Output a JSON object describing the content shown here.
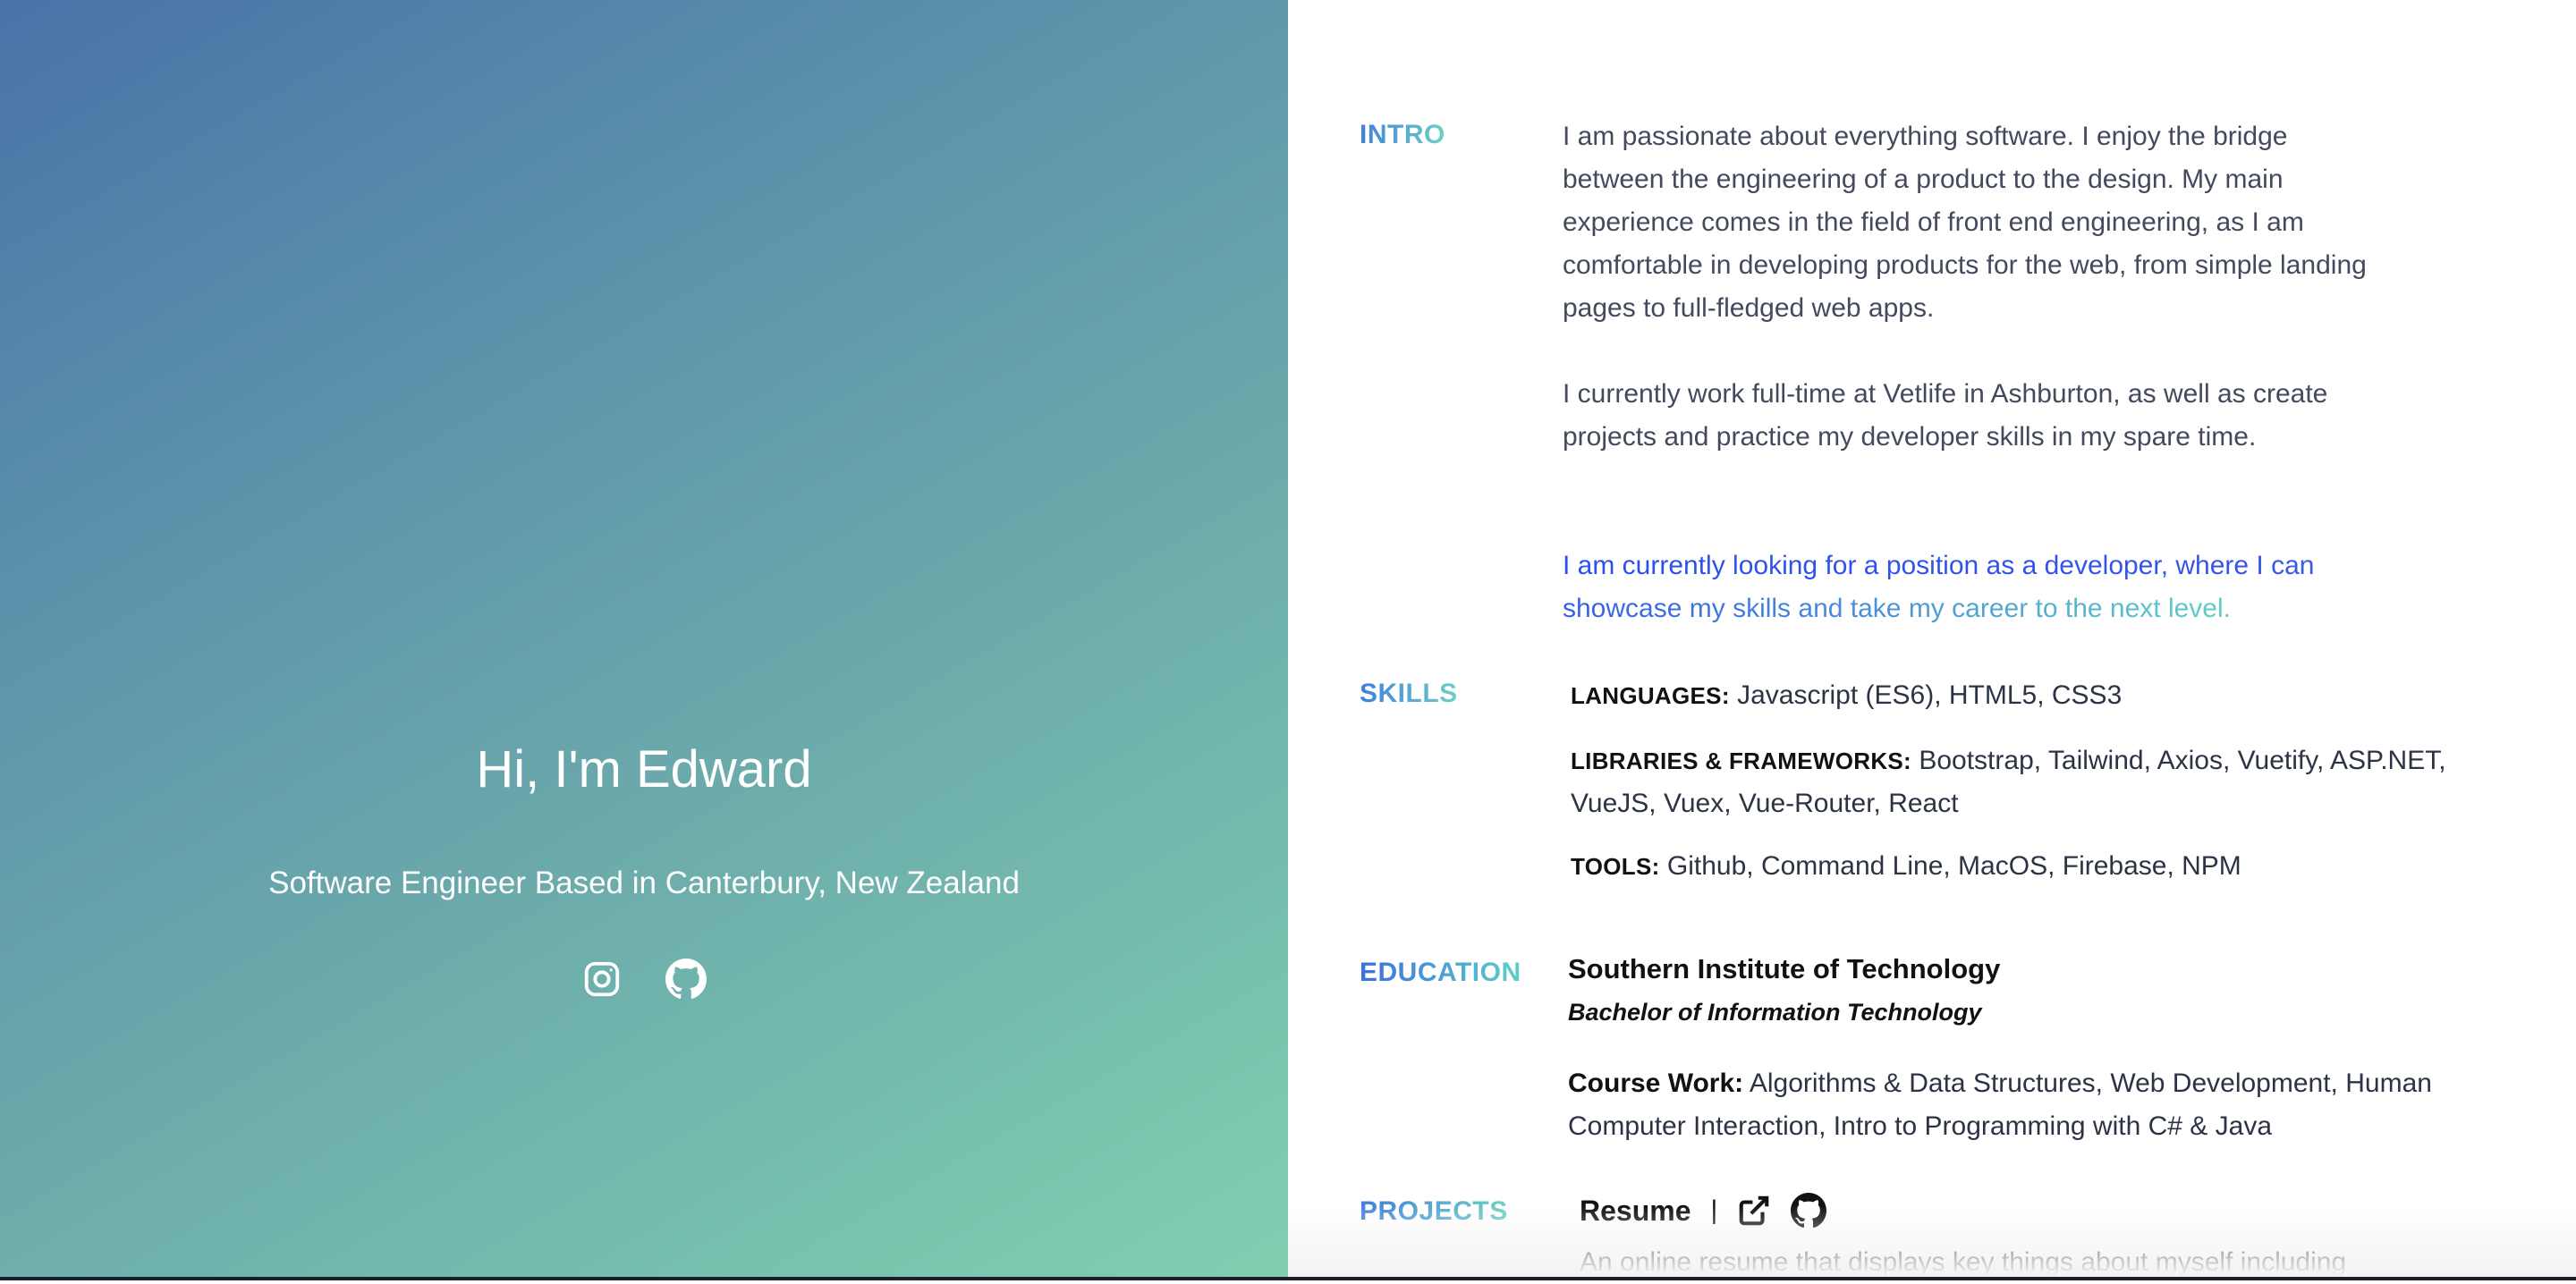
{
  "hero": {
    "title": "Hi, I'm Edward",
    "subtitle": "Software Engineer Based in Canterbury, New Zealand",
    "socials": [
      {
        "icon": "instagram-icon"
      },
      {
        "icon": "github-icon"
      }
    ]
  },
  "intro": {
    "label": "INTRO",
    "paragraphs": [
      "I am passionate about everything software. I enjoy the bridge between the engineering of a product to the design. My main experience comes in the field of front end engineering, as I am comfortable in developing products for the web, from simple landing pages to full-fledged web apps.",
      "I currently work full-time at Vetlife in Ashburton, as well as create projects and practice my developer skills in my spare time.",
      "I am currently looking for a position as a developer, where I can showcase my skills and take my career to the next level."
    ]
  },
  "skills": {
    "label": "SKILLS",
    "items": [
      {
        "title": "LANGUAGES:",
        "value": "Javascript (ES6), HTML5, CSS3"
      },
      {
        "title": "LIBRARIES & FRAMEWORKS:",
        "value": "Bootstrap, Tailwind, Axios, Vuetify, ASP.NET, VueJS, Vuex, Vue-Router, React"
      },
      {
        "title": "TOOLS:",
        "value": "Github, Command Line, MacOS, Firebase, NPM"
      }
    ]
  },
  "education": {
    "label": "EDUCATION",
    "school": "Southern Institute of Technology",
    "degree": "Bachelor of Information Technology",
    "coursework_title": "Course Work:",
    "coursework": "Algorithms & Data Structures, Web Development, Human Computer Interaction, Intro to Programming with C# & Java"
  },
  "projects": {
    "label": "PROJECTS",
    "items": [
      {
        "name": "Resume",
        "separator": "|",
        "description": "An online resume that displays key things about myself including"
      }
    ]
  },
  "colors": {
    "label_gradient_start": "#3f7fdd",
    "label_gradient_end": "#6fd1c4",
    "hero_gradient_start": "#4a72a8",
    "hero_gradient_end": "#80cfb0"
  }
}
